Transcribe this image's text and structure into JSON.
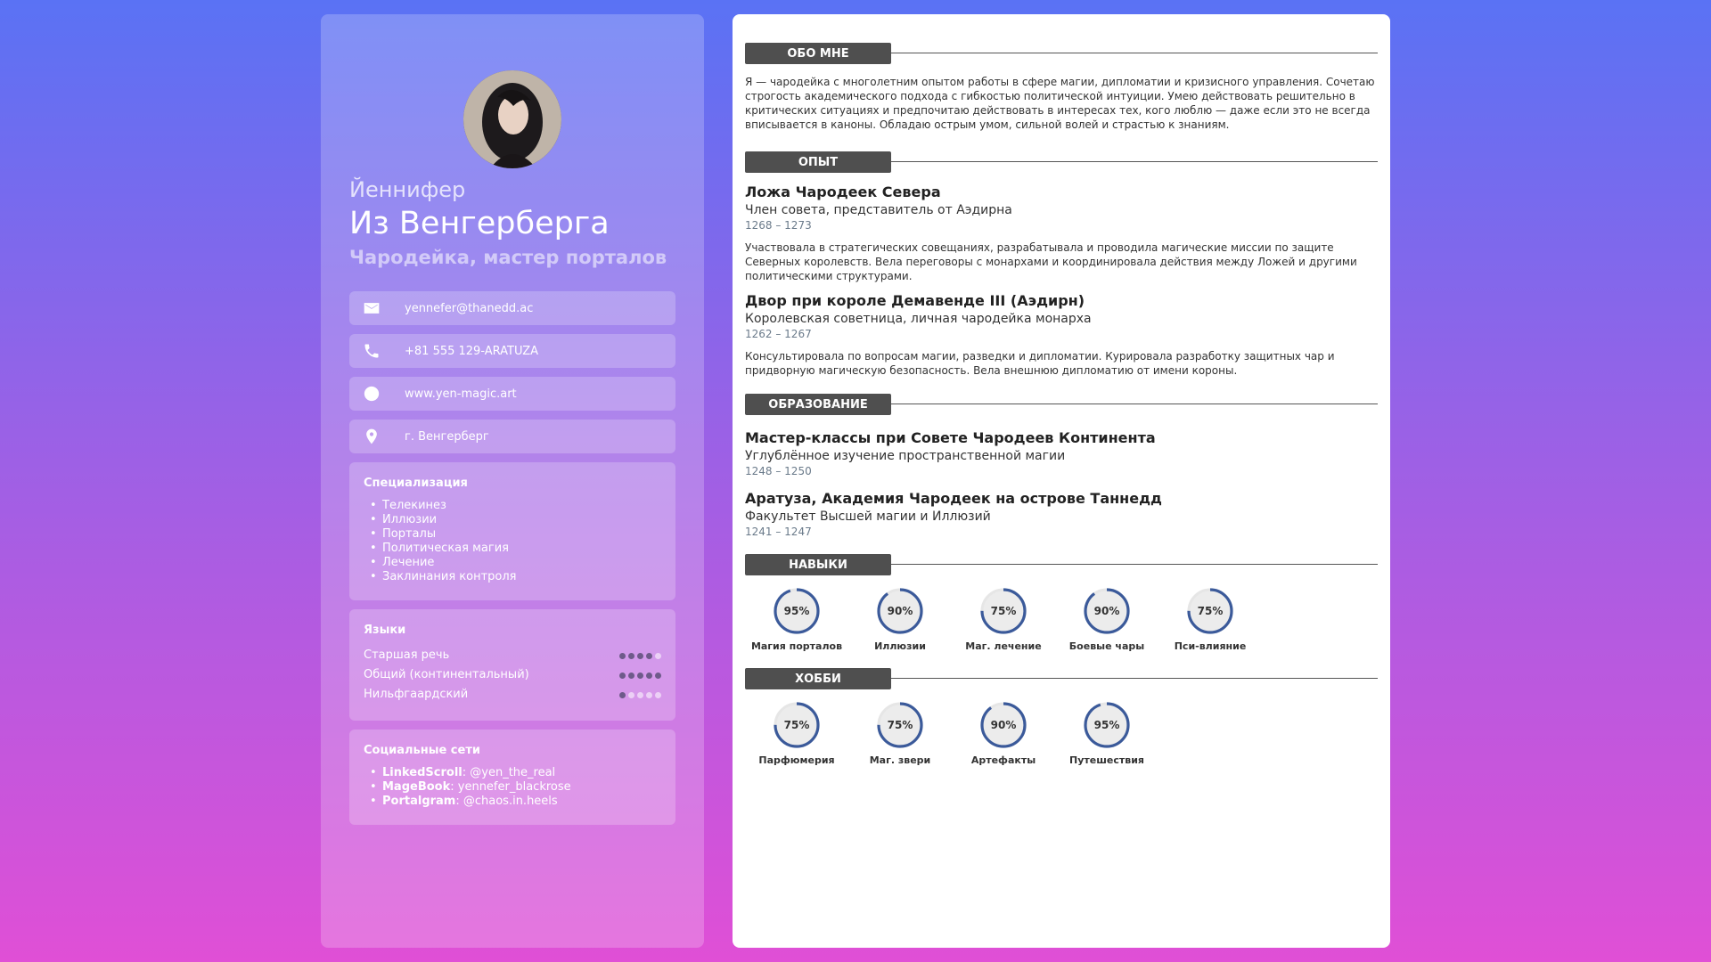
{
  "profile": {
    "first_name": "Йеннифер",
    "last_name": "Из Венгерберга",
    "role": "Чародейка, мастер порталов",
    "avatar_icon": "portrait-photo"
  },
  "contacts": [
    {
      "icon": "mail-icon",
      "text": "yennefer@thanedd.ac"
    },
    {
      "icon": "phone-icon",
      "text": "+81 555 129-ARATUZA"
    },
    {
      "icon": "globe-icon",
      "text": "www.yen-magic.art"
    },
    {
      "icon": "location-icon",
      "text": "г. Венгерберг"
    }
  ],
  "specialization": {
    "title": "Специализация",
    "items": [
      "Телекинез",
      "Иллюзии",
      "Порталы",
      "Политическая магия",
      "Лечение",
      "Заклинания контроля"
    ]
  },
  "languages": {
    "title": "Языки",
    "items": [
      {
        "name": "Старшая речь",
        "level": 4,
        "max": 5
      },
      {
        "name": "Общий (континентальный)",
        "level": 5,
        "max": 5
      },
      {
        "name": "Нильфгаардский",
        "level": 1,
        "max": 5
      }
    ]
  },
  "social": {
    "title": "Социальные сети",
    "items": [
      {
        "network": "LinkedScroll",
        "handle": ": @yen_the_real"
      },
      {
        "network": "MageBook",
        "handle": ": yennefer_blackrose"
      },
      {
        "network": "Portalgram",
        "handle": ": @chaos.in.heels"
      }
    ]
  },
  "sections": {
    "about": "ОБО МНЕ",
    "experience": "ОПЫТ",
    "education": "ОБРАЗОВАНИЕ",
    "skills": "НАВЫКИ",
    "hobbies": "ХОББИ"
  },
  "about_text": "Я — чародейка с многолетним опытом работы в сфере магии, дипломатии и кризисного управления. Сочетаю строгость академического подхода с гибкостью политической интуиции. Умею действовать решительно в критических ситуациях и предпочитаю действовать в интересах тех, кого люблю — даже если это не всегда вписывается в каноны. Обладаю острым умом, сильной волей и страстью к знаниям.",
  "experience": [
    {
      "org": "Ложа Чародеек Севера",
      "position": "Член совета, представитель от Аэдирна",
      "dates": "1268 – 1273",
      "desc": "Участвовала в стратегических совещаниях, разрабатывала и проводила магические миссии по защите Северных королевств. Вела переговоры с монархами и координировала действия между Ложей и другими политическими структурами."
    },
    {
      "org": "Двор при короле Демавенде III (Аэдирн)",
      "position": "Королевская советница, личная чародейка монарха",
      "dates": "1262 – 1267",
      "desc": "Консультировала по вопросам магии, разведки и дипломатии. Курировала разработку защитных чар и придворную магическую безопасность. Вела внешнюю дипломатию от имени короны."
    }
  ],
  "education": [
    {
      "org": "Мастер-классы при Совете Чародеев Континента",
      "position": "Углублённое изучение пространственной магии",
      "dates": "1248 – 1250"
    },
    {
      "org": "Аратуза, Академия Чародеек на острове Таннедд",
      "position": "Факультет Высшей магии и Иллюзий",
      "dates": "1241 – 1247"
    }
  ],
  "skills": [
    {
      "label": "Магия порталов",
      "value": 95,
      "text": "95%"
    },
    {
      "label": "Иллюзии",
      "value": 90,
      "text": "90%"
    },
    {
      "label": "Маг. лечение",
      "value": 75,
      "text": "75%"
    },
    {
      "label": "Боевые чары",
      "value": 90,
      "text": "90%"
    },
    {
      "label": "Пси-влияние",
      "value": 75,
      "text": "75%"
    }
  ],
  "hobbies": [
    {
      "label": "Парфюмерия",
      "value": 75,
      "text": "75%"
    },
    {
      "label": "Маг. звери",
      "value": 75,
      "text": "75%"
    },
    {
      "label": "Артефакты",
      "value": 90,
      "text": "90%"
    },
    {
      "label": "Путешествия",
      "value": 95,
      "text": "95%"
    }
  ],
  "colors": {
    "ring": "#3b5a9a",
    "ring_track": "#e6e6e6",
    "tag_bg": "#4f4f4f"
  }
}
